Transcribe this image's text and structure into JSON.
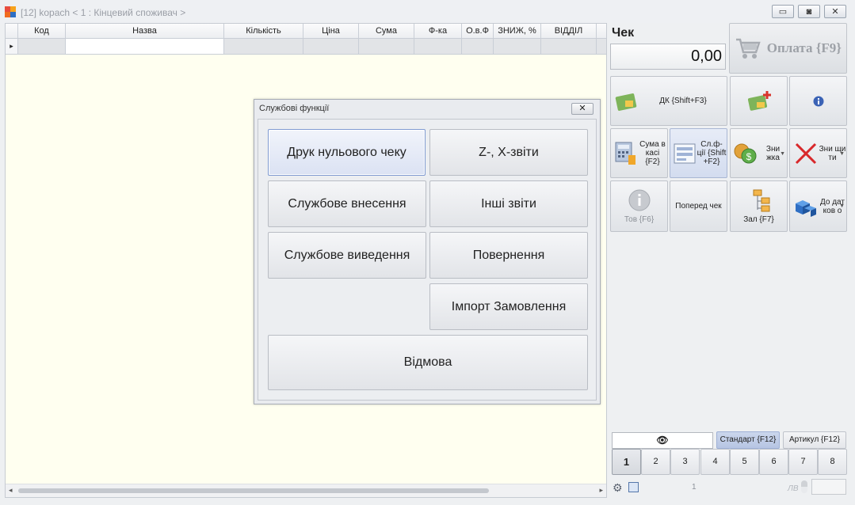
{
  "window": {
    "title": "[12] kopach <   1 : Кінцевий споживач >",
    "minimize_icon": "▭",
    "restore_icon": "◙",
    "close_icon": "✕"
  },
  "grid": {
    "columns": [
      "Код",
      "Назва",
      "Кількість",
      "Ціна",
      "Сума",
      "Ф-ка",
      "О.в.Ф",
      "ЗНИЖ, %",
      "ВІДДІЛ"
    ],
    "row_marker": "▸"
  },
  "dialog": {
    "title": "Службові функції",
    "close_icon": "✕",
    "buttons": {
      "print_zero": "Друк нульового чеку",
      "z_x_reports": "Z-, X-звіти",
      "service_in": "Службове внесення",
      "other_reports": "Інші звіти",
      "service_out": "Службове виведення",
      "return": "Повернення",
      "import_order": "Імпорт Замовлення",
      "cancel": "Відмова"
    }
  },
  "receipt": {
    "label": "Чек",
    "total": "0,00",
    "pay_button": "Оплата {F9}"
  },
  "toolbar": {
    "dk": "ДК {Shift+F3}",
    "cash_sum": "Сума в касі {F2}",
    "service_functions": "Сл.ф-ції {Shift +F2}",
    "discount": "Зни жка",
    "destroy": "Зни щи ти",
    "product": "Тов {F6}",
    "prev_check": "Поперед чек",
    "hall": "Зал {F7}",
    "additional": "До дат ков о"
  },
  "mode": {
    "standard": "Стандарт {F12}",
    "article": "Артикул {F12}"
  },
  "keypad": [
    "1",
    "2",
    "3",
    "4",
    "5",
    "6",
    "7",
    "8"
  ],
  "statusbar": {
    "page": "1",
    "lv": "ЛВ"
  },
  "colors": {
    "background": "#eef0f2",
    "grid_background": "#fffff0",
    "accent_blue": "#7f9ad1"
  }
}
